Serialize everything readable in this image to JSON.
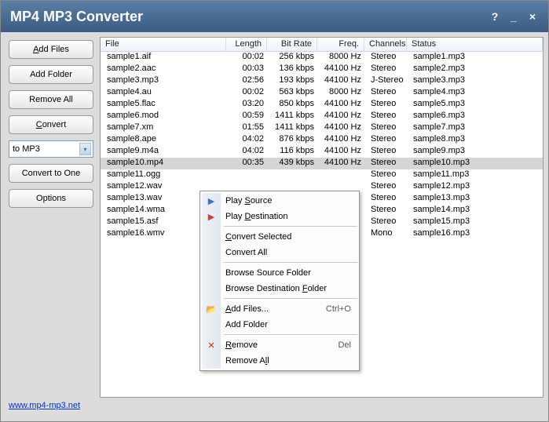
{
  "title": "MP4 MP3 Converter",
  "titlebar_buttons": {
    "help": "?",
    "min": "_",
    "close": "×"
  },
  "sidebar": {
    "add_files": "Add Files",
    "add_files_u": "A",
    "add_folder": "Add Folder",
    "remove_all": "Remove All",
    "convert": "Convert",
    "convert_u": "C",
    "format": "to MP3",
    "convert_one": "Convert to One",
    "options": "Options"
  },
  "columns": {
    "file": "File",
    "length": "Length",
    "bitrate": "Bit Rate",
    "freq": "Freq.",
    "channels": "Channels",
    "status": "Status"
  },
  "rows": [
    {
      "file": "sample1.aif",
      "len": "00:02",
      "br": "256 kbps",
      "fr": "8000 Hz",
      "ch": "Stereo",
      "st": "sample1.mp3"
    },
    {
      "file": "sample2.aac",
      "len": "00:03",
      "br": "136 kbps",
      "fr": "44100 Hz",
      "ch": "Stereo",
      "st": "sample2.mp3"
    },
    {
      "file": "sample3.mp3",
      "len": "02:56",
      "br": "193 kbps",
      "fr": "44100 Hz",
      "ch": "J-Stereo",
      "st": "sample3.mp3"
    },
    {
      "file": "sample4.au",
      "len": "00:02",
      "br": "563 kbps",
      "fr": "8000 Hz",
      "ch": "Stereo",
      "st": "sample4.mp3"
    },
    {
      "file": "sample5.flac",
      "len": "03:20",
      "br": "850 kbps",
      "fr": "44100 Hz",
      "ch": "Stereo",
      "st": "sample5.mp3"
    },
    {
      "file": "sample6.mod",
      "len": "00:59",
      "br": "1411 kbps",
      "fr": "44100 Hz",
      "ch": "Stereo",
      "st": "sample6.mp3"
    },
    {
      "file": "sample7.xm",
      "len": "01:55",
      "br": "1411 kbps",
      "fr": "44100 Hz",
      "ch": "Stereo",
      "st": "sample7.mp3"
    },
    {
      "file": "sample8.ape",
      "len": "04:02",
      "br": "876 kbps",
      "fr": "44100 Hz",
      "ch": "Stereo",
      "st": "sample8.mp3"
    },
    {
      "file": "sample9.m4a",
      "len": "04:02",
      "br": "116 kbps",
      "fr": "44100 Hz",
      "ch": "Stereo",
      "st": "sample9.mp3"
    },
    {
      "file": "sample10.mp4",
      "len": "00:35",
      "br": "439 kbps",
      "fr": "44100 Hz",
      "ch": "Stereo",
      "st": "sample10.mp3",
      "sel": true
    },
    {
      "file": "sample11.ogg",
      "len": "",
      "br": "",
      "fr": "",
      "ch": "Stereo",
      "st": "sample11.mp3"
    },
    {
      "file": "sample12.wav",
      "len": "",
      "br": "",
      "fr": "",
      "ch": "Stereo",
      "st": "sample12.mp3"
    },
    {
      "file": "sample13.wav",
      "len": "",
      "br": "",
      "fr": "",
      "ch": "Stereo",
      "st": "sample13.mp3"
    },
    {
      "file": "sample14.wma",
      "len": "",
      "br": "",
      "fr": "",
      "ch": "Stereo",
      "st": "sample14.mp3"
    },
    {
      "file": "sample15.asf",
      "len": "",
      "br": "",
      "fr": "",
      "ch": "Stereo",
      "st": "sample15.mp3"
    },
    {
      "file": "sample16.wmv",
      "len": "",
      "br": "",
      "fr": "",
      "ch": "Mono",
      "st": "sample16.mp3"
    }
  ],
  "ctx": {
    "play_source": "Play Source",
    "play_source_u": "S",
    "play_dest": "Play Destination",
    "play_dest_u": "D",
    "convert_sel": "Convert Selected",
    "convert_sel_u": "C",
    "convert_all": "Convert All",
    "browse_src": "Browse Source Folder",
    "browse_dest": "Browse Destination Folder",
    "browse_dest_u": "F",
    "add_files": "Add Files...",
    "add_files_u": "A",
    "add_files_sc": "Ctrl+O",
    "add_folder": "Add Folder",
    "remove": "Remove",
    "remove_u": "R",
    "remove_sc": "Del",
    "remove_all": "Remove All",
    "remove_all_u": "l"
  },
  "footer_link": "www.mp4-mp3.net"
}
